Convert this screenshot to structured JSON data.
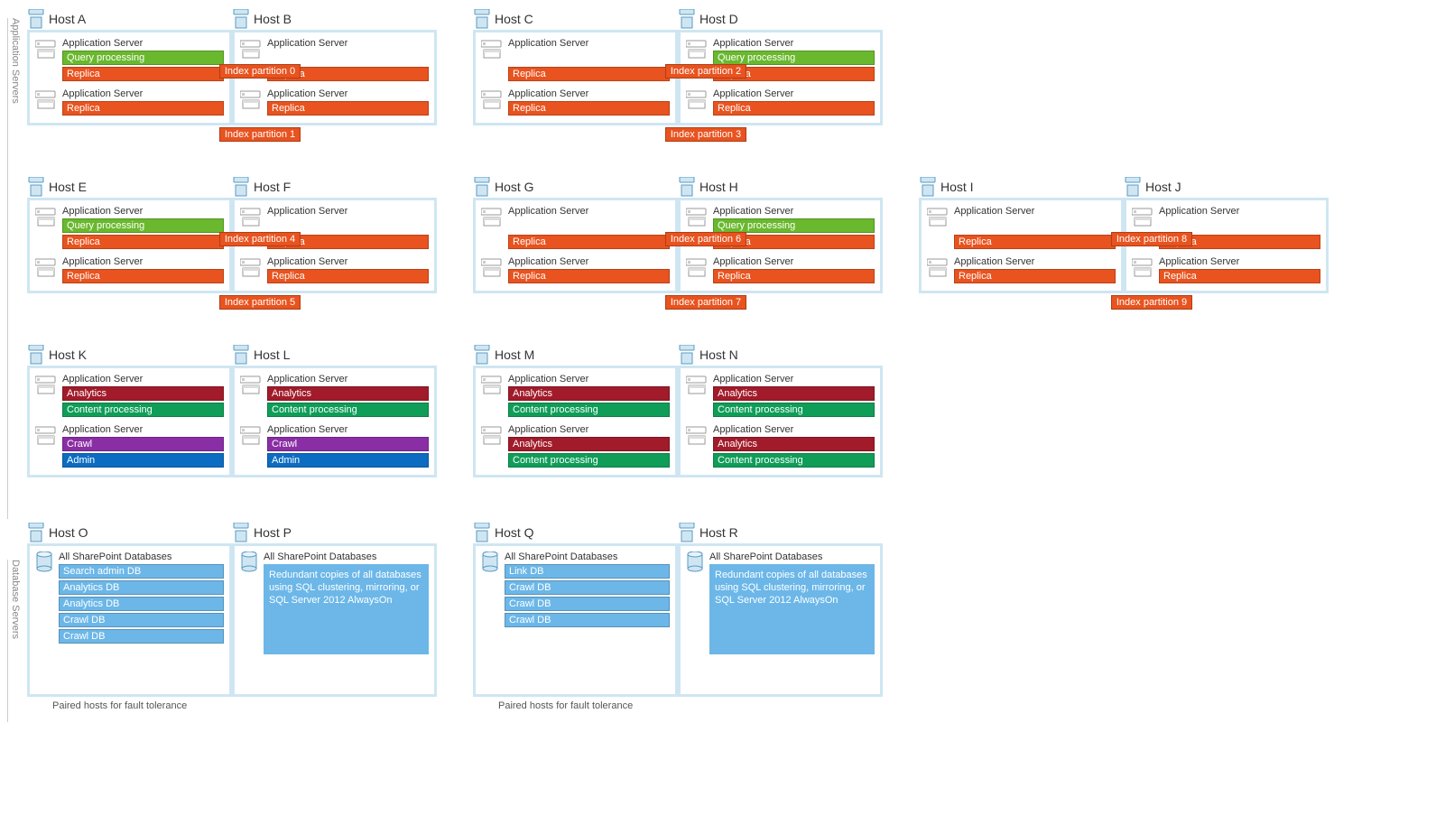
{
  "labels": {
    "section_app": "Application Servers",
    "section_db": "Database Servers",
    "app_server": "Application Server",
    "all_sp_db": "All SharePoint Databases",
    "pair_caption": "Paired hosts for fault tolerance",
    "redundant_copy": "Redundant copies of all databases using SQL clustering, mirroring, or SQL Server 2012 AlwaysOn"
  },
  "components": {
    "query": "Query processing",
    "replica": "Replica",
    "analytics": "Analytics",
    "content": "Content processing",
    "crawl": "Crawl",
    "admin": "Admin"
  },
  "partitions": {
    "p0": "Index partition 0",
    "p1": "Index partition 1",
    "p2": "Index partition 2",
    "p3": "Index partition 3",
    "p4": "Index partition 4",
    "p5": "Index partition 5",
    "p6": "Index partition 6",
    "p7": "Index partition 7",
    "p8": "Index partition 8",
    "p9": "Index partition 9"
  },
  "hosts": {
    "A": "Host A",
    "B": "Host B",
    "C": "Host C",
    "D": "Host D",
    "E": "Host E",
    "F": "Host F",
    "G": "Host G",
    "H": "Host H",
    "I": "Host I",
    "J": "Host J",
    "K": "Host K",
    "L": "Host L",
    "M": "Host M",
    "N": "Host N",
    "O": "Host O",
    "P": "Host P",
    "Q": "Host Q",
    "R": "Host R"
  },
  "databases": {
    "search_admin": "Search admin DB",
    "analytics": "Analytics DB",
    "crawl": "Crawl DB",
    "link": "Link DB"
  }
}
